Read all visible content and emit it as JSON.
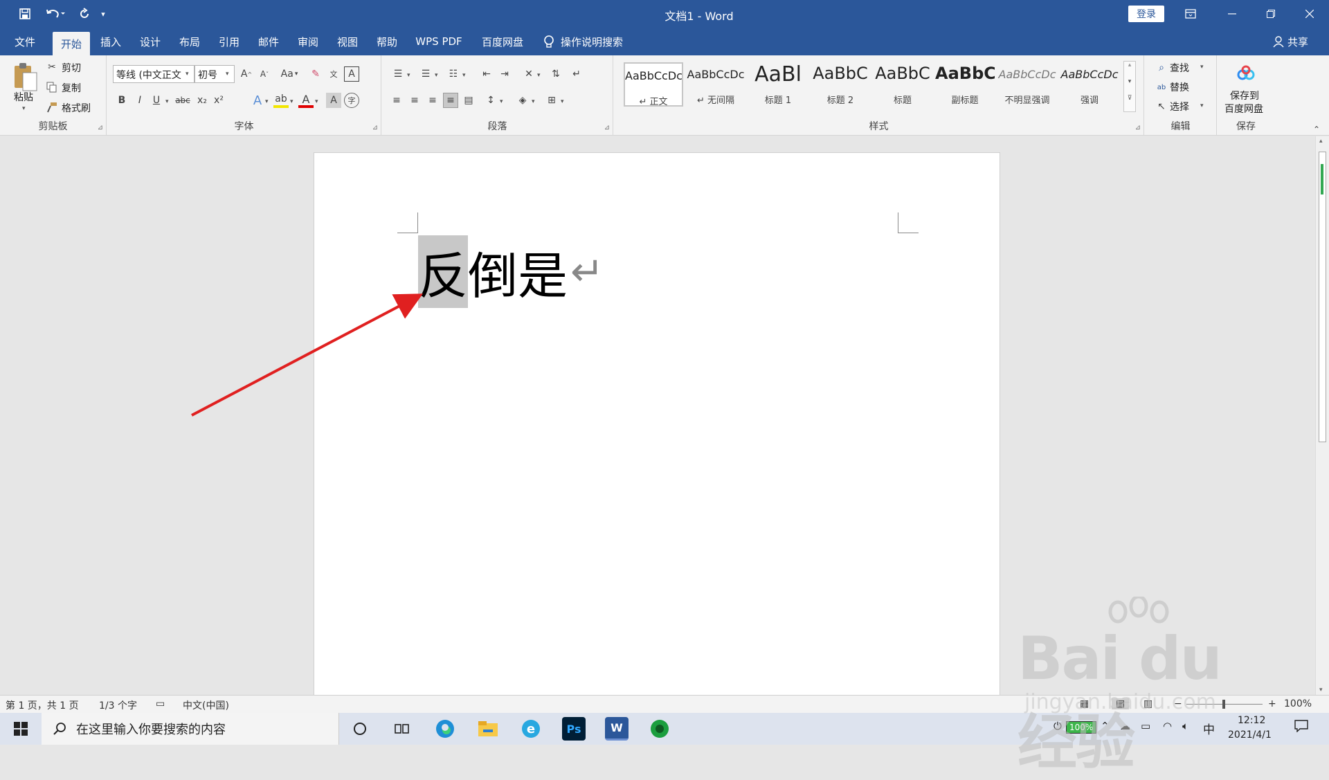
{
  "titlebar": {
    "title": "文档1  -  Word",
    "login": "登录",
    "qat_more": "▾"
  },
  "tabs": [
    {
      "label": "文件"
    },
    {
      "label": "开始"
    },
    {
      "label": "插入"
    },
    {
      "label": "设计"
    },
    {
      "label": "布局"
    },
    {
      "label": "引用"
    },
    {
      "label": "邮件"
    },
    {
      "label": "审阅"
    },
    {
      "label": "视图"
    },
    {
      "label": "帮助"
    },
    {
      "label": "WPS PDF"
    },
    {
      "label": "百度网盘"
    }
  ],
  "tell_me": "操作说明搜索",
  "share": "共享",
  "ribbon": {
    "clipboard": {
      "group": "剪贴板",
      "paste": "粘贴",
      "cut": "剪切",
      "copy": "复制",
      "format_painter": "格式刷"
    },
    "font": {
      "group": "字体",
      "font_name": "等线 (中文正文",
      "font_size": "初号",
      "case": "Aa",
      "bold": "B",
      "italic": "I",
      "underline": "U",
      "strike": "abc",
      "sub": "x₂",
      "sup": "x²"
    },
    "paragraph": {
      "group": "段落"
    },
    "styles": {
      "group": "样式",
      "items": [
        {
          "sample": "AaBbCcDc",
          "name": "↵ 正文"
        },
        {
          "sample": "AaBbCcDc",
          "name": "↵ 无间隔"
        },
        {
          "sample": "AaBl",
          "name": "标题 1"
        },
        {
          "sample": "AaBbC",
          "name": "标题 2"
        },
        {
          "sample": "AaBbC",
          "name": "标题"
        },
        {
          "sample": "AaBbC",
          "name": "副标题"
        },
        {
          "sample": "AaBbCcDc",
          "name": "不明显强调"
        },
        {
          "sample": "AaBbCcDc",
          "name": "强调"
        }
      ]
    },
    "editing": {
      "group": "编辑",
      "find": "查找",
      "replace": "替换",
      "select": "选择"
    },
    "save": {
      "group": "保存",
      "label_line1": "保存到",
      "label_line2": "百度网盘"
    }
  },
  "document": {
    "selected_char": "反",
    "rest_text": "倒是",
    "paragraph_mark": "↵"
  },
  "status": {
    "page": "第 1 页，共 1 页",
    "words": "1/3 个字",
    "language": "中文(中国)",
    "zoom": "100%"
  },
  "taskbar": {
    "search_placeholder": "在这里输入你要搜索的内容",
    "battery": "100%",
    "ime": "中",
    "time": "12:12",
    "date": "2021/4/1"
  },
  "watermark": {
    "brand": "Bai du 经验",
    "url": "jingyan.baidu.com"
  }
}
